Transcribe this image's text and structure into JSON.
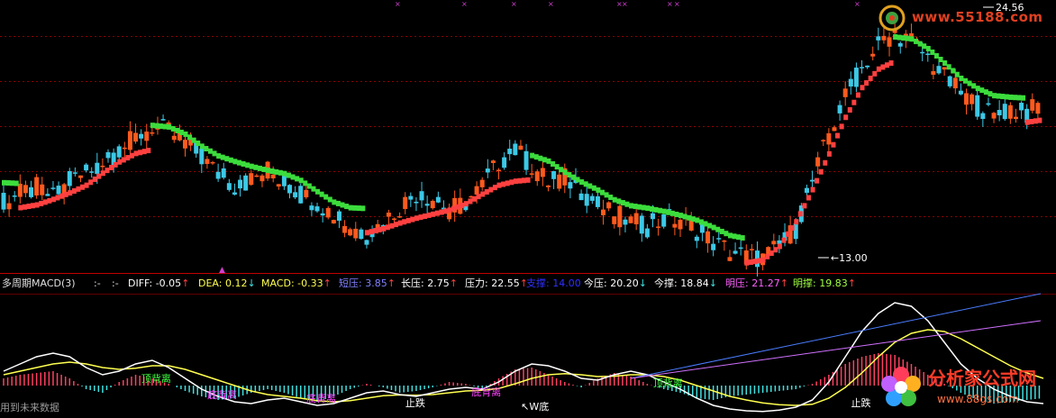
{
  "watermark_site": "www.55188.com",
  "watermark_bottom": "用到未来数据",
  "logo2_title": "分析家公式网",
  "logo2_url": "www.88gs.com",
  "colors": {
    "up": "#ff5a1e",
    "down": "#3cc8e6",
    "support": "#ff4040",
    "resist": "#3cdc3c",
    "diff": "#ffffff",
    "dea": "#ffff50",
    "macd_up": "#ff4060",
    "macd_down": "#40e0e0",
    "trend_blue": "#4a7cff",
    "trend_pink": "#d070ff",
    "grid": "#8b0000"
  },
  "info_bar": {
    "name": "多周期MACD(3)",
    "dash1": ":-",
    "dash2": ":-",
    "items": [
      {
        "label": "DIFF:",
        "value": "-0.05",
        "arrow": "↑",
        "color": "#ffffff",
        "arrow_color": "#ff4040"
      },
      {
        "label": "DEA:",
        "value": "0.12",
        "arrow": "↓",
        "color": "#ffff50",
        "arrow_color": "#40e0e0"
      },
      {
        "label": "MACD:",
        "value": "-0.33",
        "arrow": "↑",
        "color": "#ffff50",
        "arrow_color": "#ff4040"
      },
      {
        "label": "短压:",
        "value": "3.85",
        "arrow": "↑",
        "color": "#8080ff",
        "arrow_color": "#ff4040"
      },
      {
        "label": "长压:",
        "value": "2.75",
        "arrow": "↑",
        "color": "#ffffff",
        "arrow_color": "#ff4040"
      },
      {
        "label": "压力:",
        "value": "22.55",
        "arrow": "↑",
        "color": "#ffffff",
        "arrow_color": "#ff4040"
      },
      {
        "label": "支撑:",
        "value": "14.00",
        "arrow": "",
        "color": "#3030ff",
        "arrow_color": "#ff4040"
      },
      {
        "label": "今压:",
        "value": "20.20",
        "arrow": "↓",
        "color": "#ffffff",
        "arrow_color": "#40e0e0"
      },
      {
        "label": "今撑:",
        "value": "18.84",
        "arrow": "↓",
        "color": "#ffffff",
        "arrow_color": "#40e0e0"
      },
      {
        "label": "明压:",
        "value": "21.27",
        "arrow": "↑",
        "color": "#ff60ff",
        "arrow_color": "#ff4040"
      },
      {
        "label": "明撑:",
        "value": "19.83",
        "arrow": "↑",
        "color": "#a0ff40",
        "arrow_color": "#ff4040"
      }
    ]
  },
  "chart_data": [
    {
      "type": "candlestick",
      "annotations": [
        {
          "text": "24.56",
          "at_index": 60
        },
        {
          "text": "13.00",
          "at_index": 50
        }
      ],
      "close_path": [
        15.8,
        16.2,
        16.5,
        16.0,
        16.8,
        17.2,
        17.8,
        18.4,
        19.0,
        19.6,
        19.3,
        18.8,
        18.0,
        17.2,
        16.6,
        16.9,
        17.4,
        16.8,
        16.2,
        15.8,
        15.2,
        14.6,
        14.2,
        14.8,
        15.6,
        16.2,
        16.0,
        15.4,
        15.8,
        16.6,
        17.8,
        18.4,
        17.6,
        16.8,
        17.0,
        16.4,
        15.6,
        15.2,
        14.8,
        14.6,
        14.9,
        15.0,
        14.4,
        13.8,
        13.4,
        13.1,
        13.0,
        13.6,
        14.5,
        16.8,
        19.2,
        21.0,
        22.5,
        23.6,
        24.2,
        23.8,
        23.0,
        22.0,
        21.2,
        20.6,
        20.0,
        20.5,
        20.2,
        20.8
      ],
      "support_start": 0,
      "support_end": 46,
      "xlim": [
        0,
        63
      ]
    },
    {
      "type": "macd",
      "labels": [
        {
          "text": "顶背离",
          "at_index": 9
        },
        {
          "text": "底背离",
          "at_index": 13
        },
        {
          "text": "底背离",
          "at_index": 19
        },
        {
          "text": "止跌",
          "at_index": 25
        },
        {
          "text": "底背离",
          "at_index": 29
        },
        {
          "text": "↖W底",
          "at_index": 32
        },
        {
          "text": "顶背离",
          "at_index": 40
        },
        {
          "text": "止跌",
          "at_index": 52
        }
      ],
      "histogram": [
        0.2,
        0.3,
        0.35,
        0.4,
        0.2,
        -0.1,
        -0.2,
        0.1,
        0.3,
        0.2,
        0.05,
        -0.15,
        -0.3,
        -0.4,
        -0.35,
        -0.2,
        -0.1,
        -0.2,
        -0.35,
        -0.45,
        -0.3,
        -0.1,
        0.05,
        -0.05,
        -0.2,
        -0.15,
        -0.05,
        0.1,
        0.05,
        -0.1,
        0.2,
        0.45,
        0.5,
        0.3,
        0.1,
        -0.05,
        0.2,
        0.35,
        0.25,
        0.05,
        -0.1,
        -0.2,
        -0.35,
        -0.4,
        -0.3,
        -0.25,
        -0.2,
        -0.15,
        -0.1,
        0.05,
        0.3,
        0.6,
        0.8,
        0.9,
        0.85,
        0.6,
        0.3,
        0.05,
        -0.2,
        -0.4,
        -0.5,
        -0.45,
        -0.4,
        -0.35
      ],
      "diff": [
        0.4,
        0.6,
        0.8,
        0.9,
        0.8,
        0.5,
        0.3,
        0.4,
        0.6,
        0.7,
        0.5,
        0.2,
        -0.1,
        -0.3,
        -0.45,
        -0.5,
        -0.4,
        -0.35,
        -0.45,
        -0.55,
        -0.5,
        -0.35,
        -0.2,
        -0.15,
        -0.25,
        -0.3,
        -0.2,
        -0.1,
        -0.05,
        -0.1,
        0.1,
        0.4,
        0.6,
        0.55,
        0.4,
        0.2,
        0.15,
        0.3,
        0.4,
        0.3,
        0.1,
        -0.1,
        -0.35,
        -0.55,
        -0.65,
        -0.7,
        -0.72,
        -0.68,
        -0.6,
        -0.4,
        0.1,
        0.8,
        1.5,
        2.0,
        2.3,
        2.2,
        1.8,
        1.2,
        0.6,
        0.2,
        -0.1,
        -0.3,
        -0.45,
        -0.5
      ],
      "dea": [
        0.3,
        0.4,
        0.5,
        0.6,
        0.65,
        0.6,
        0.5,
        0.45,
        0.48,
        0.55,
        0.55,
        0.45,
        0.3,
        0.15,
        0.0,
        -0.15,
        -0.25,
        -0.3,
        -0.35,
        -0.42,
        -0.45,
        -0.42,
        -0.35,
        -0.28,
        -0.26,
        -0.27,
        -0.25,
        -0.2,
        -0.15,
        -0.13,
        -0.08,
        0.05,
        0.2,
        0.3,
        0.33,
        0.3,
        0.25,
        0.26,
        0.3,
        0.3,
        0.25,
        0.15,
        0.0,
        -0.15,
        -0.3,
        -0.4,
        -0.48,
        -0.53,
        -0.55,
        -0.52,
        -0.35,
        -0.05,
        0.35,
        0.8,
        1.2,
        1.45,
        1.55,
        1.5,
        1.3,
        1.05,
        0.8,
        0.55,
        0.35,
        0.2
      ],
      "xlim": [
        0,
        63
      ]
    }
  ]
}
